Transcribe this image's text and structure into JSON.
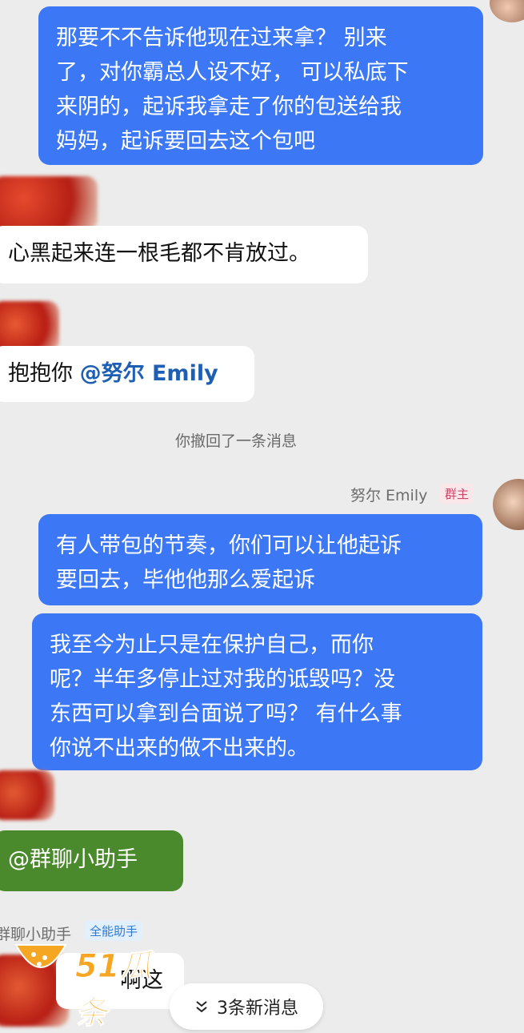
{
  "colors": {
    "outgoing_bubble": "#3c78f5",
    "incoming_bubble": "#ffffff",
    "mention_text": "#1e5fb4",
    "green_bubble": "#4a8a2c"
  },
  "messages": {
    "m1": {
      "lines": [
        "那要不不告诉他现在过来拿？ 别来",
        "了，对你霸总人设不好， 可以私底下",
        "来阴的，起诉我拿走了你的包送给我",
        "妈妈，起诉要回去这个包吧"
      ]
    },
    "m2": {
      "text": "心黑起来连一根毛都不肯放过。"
    },
    "m3": {
      "prefix": "抱抱你 ",
      "mention": "@努尔 Emily"
    },
    "recall": "你撤回了一条消息",
    "owner": {
      "name": "努尔 Emily",
      "badge": "群主"
    },
    "m4": {
      "lines": [
        "有人带包的节奏，你们可以让他起诉",
        "要回去，毕他他那么爱起诉"
      ]
    },
    "m5": {
      "lines": [
        "我至今为止只是在保护自己，而你",
        "呢？半年多停止过对我的诋毁吗？没",
        "东西可以拿到台面说了吗？ 有什么事",
        "你说不出来的做不出来的。"
      ]
    },
    "m6": {
      "text": "@群聊小助手"
    },
    "assistant": {
      "name": "群聊小助手",
      "badge": "全能助手"
    },
    "m7": {
      "text": "啊这"
    }
  },
  "new_messages": {
    "label": "3条新消息",
    "icon": "double-chevron-down-icon"
  },
  "watermark": {
    "text": "51瓜条",
    "icon": "watermelon-logo"
  }
}
